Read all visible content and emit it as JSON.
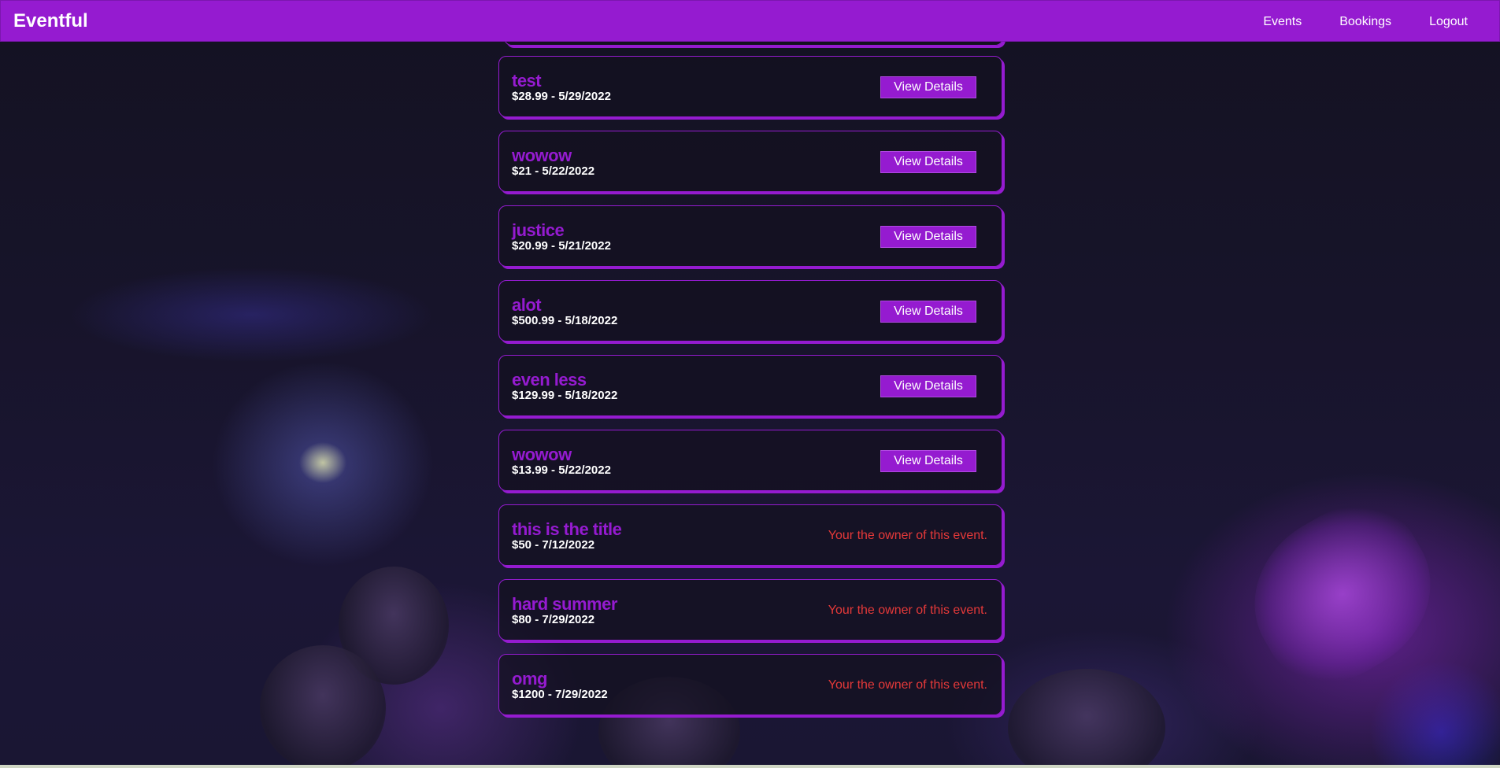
{
  "navbar": {
    "brand": "Eventful",
    "links": [
      "Events",
      "Bookings",
      "Logout"
    ]
  },
  "events": [
    {
      "title": "test",
      "price_date": "$28.99 - 5/29/2022",
      "action": "View Details"
    },
    {
      "title": "wowow",
      "price_date": "$21 - 5/22/2022",
      "action": "View Details"
    },
    {
      "title": "justice",
      "price_date": "$20.99 - 5/21/2022",
      "action": "View Details"
    },
    {
      "title": "alot",
      "price_date": "$500.99 - 5/18/2022",
      "action": "View Details"
    },
    {
      "title": "even less",
      "price_date": "$129.99 - 5/18/2022",
      "action": "View Details"
    },
    {
      "title": "wowow",
      "price_date": "$13.99 - 5/22/2022",
      "action": "View Details"
    },
    {
      "title": "this is the title",
      "price_date": "$50 - 7/12/2022",
      "owner_note": "Your the owner of this event."
    },
    {
      "title": "hard summer",
      "price_date": "$80 - 7/29/2022",
      "owner_note": "Your the owner of this event."
    },
    {
      "title": "omg",
      "price_date": "$1200 - 7/29/2022",
      "owner_note": "Your the owner of this event."
    }
  ],
  "colors": {
    "accent": "#951bd0",
    "owner_note": "#e53939",
    "text": "#ffffff"
  }
}
